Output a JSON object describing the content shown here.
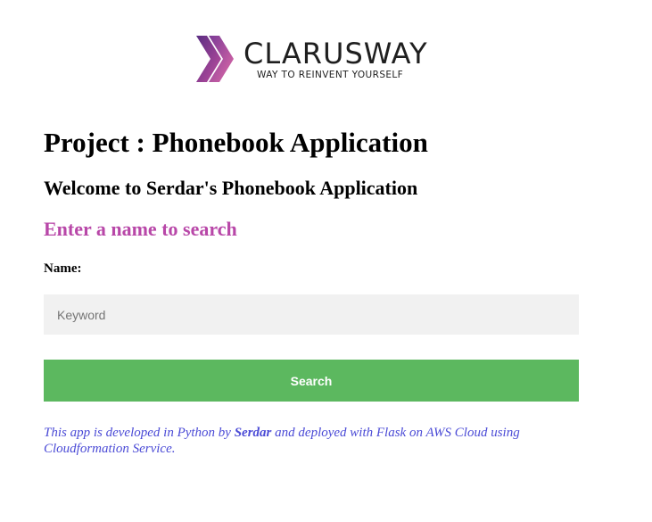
{
  "logo": {
    "brand": "CLARUSWAY",
    "tagline": "WAY TO REINVENT YOURSELF"
  },
  "header": {
    "title": "Project : Phonebook Application",
    "welcome": "Welcome to Serdar's Phonebook Application",
    "prompt": "Enter a name to search"
  },
  "form": {
    "name_label": "Name:",
    "input_placeholder": "Keyword",
    "input_value": "",
    "search_label": "Search"
  },
  "footer": {
    "text_before": "This app is developed in Python by ",
    "author": "Serdar",
    "text_after": " and deployed with Flask on AWS Cloud using Cloudformation Service."
  },
  "colors": {
    "prompt": "#b847a8",
    "search_button": "#5cb85f",
    "input_background": "#f1f1f1",
    "footer_text": "#4b4bd6",
    "logo_chevron_dark": "#5a2d82",
    "logo_chevron_light": "#c04fa0"
  },
  "icons": {
    "logo_mark": "double-chevron-logo"
  }
}
